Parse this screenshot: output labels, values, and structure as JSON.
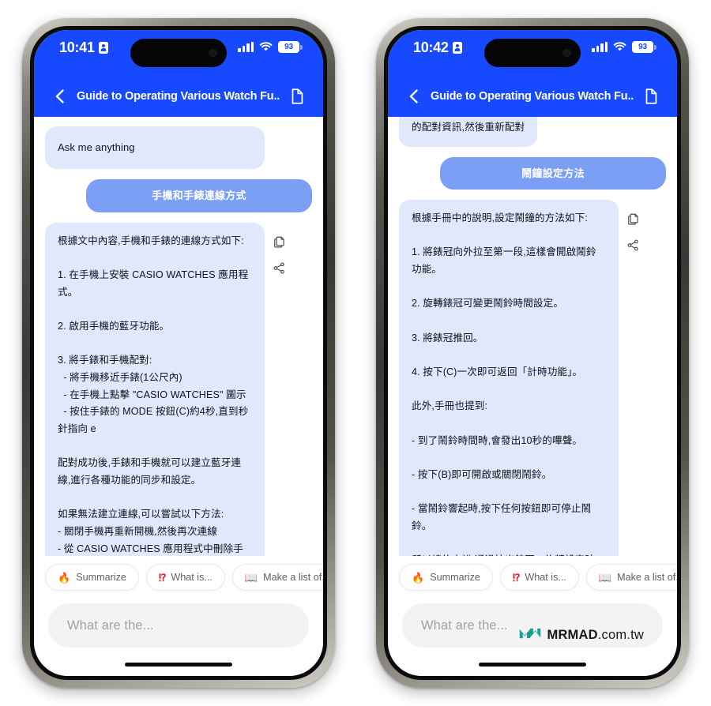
{
  "watermark": {
    "brand": "MRMAD",
    "domain": ".com.tw",
    "logo_color": "#1a9e93",
    "icon": "mrmad-logo-icon"
  },
  "theme": {
    "header_blue": "#1749ff",
    "user_bubble_blue": "#7c9ff6",
    "ai_bubble_blue": "#dfe9fb",
    "input_gray": "#f3f3f3"
  },
  "phones": [
    {
      "id": "left",
      "status": {
        "time": "10:41",
        "id_icon": "id-badge-icon",
        "signal_icon": "cellular-signal-icon",
        "wifi_icon": "wifi-icon",
        "battery_level": "93"
      },
      "nav": {
        "back_icon": "chevron-left-icon",
        "title": "Guide to Operating Various Watch Fu...",
        "doc_icon": "document-icon"
      },
      "messages": [
        {
          "role": "assistant",
          "kind": "greeting",
          "text": "Ask me anything"
        },
        {
          "role": "user",
          "text": "手機和手錶連線方式"
        },
        {
          "role": "assistant",
          "kind": "answer",
          "text": "根據文中內容,手機和手錶的連線方式如下:\n\n1. 在手機上安裝 CASIO WATCHES 應用程式。\n\n2. 啟用手機的藍牙功能。\n\n3. 將手錶和手機配對:\n  - 將手機移近手錶(1公尺內)\n  - 在手機上點擊 \"CASIO WATCHES\" 圖示\n  - 按住手錶的 MODE 按鈕(C)約4秒,直到秒針指向 e\n\n配對成功後,手錶和手機就可以建立藍牙連線,進行各種功能的同步和設定。\n\n如果無法建立連線,可以嘗試以下方法:\n- 關閉手機再重新開機,然後再次連線\n- 從 CASIO WATCHES 應用程式中刪除手錶的配對資訊,然後重新配對",
          "actions": [
            {
              "name": "copy-icon",
              "label": "Copy"
            },
            {
              "name": "share-icon",
              "label": "Share"
            }
          ]
        }
      ],
      "chips": [
        {
          "emoji": "🔥",
          "icon": "fire-icon",
          "label": "Summarize"
        },
        {
          "emoji": "⁉",
          "icon": "exclamation-question-icon",
          "label": "What is..."
        },
        {
          "emoji": "📖",
          "icon": "book-icon",
          "label": "Make a list of..."
        }
      ],
      "composer": {
        "placeholder": "What are the..."
      }
    },
    {
      "id": "right",
      "status": {
        "time": "10:42",
        "id_icon": "id-badge-icon",
        "signal_icon": "cellular-signal-icon",
        "wifi_icon": "wifi-icon",
        "battery_level": "93"
      },
      "nav": {
        "back_icon": "chevron-left-icon",
        "title": "Guide to Operating Various Watch Fu...",
        "doc_icon": "document-icon"
      },
      "messages": [
        {
          "role": "assistant",
          "kind": "clipped",
          "text": "的配對資訊,然後重新配對"
        },
        {
          "role": "user",
          "text": "鬧鐘設定方法"
        },
        {
          "role": "assistant",
          "kind": "answer",
          "text": "根據手冊中的說明,設定鬧鐘的方法如下:\n\n1. 將錶冠向外拉至第一段,這樣會開啟鬧鈴功能。\n\n2. 旋轉錶冠可變更鬧鈴時間設定。\n\n3. 將錶冠推回。\n\n4. 按下(C)一次即可返回「計時功能」。\n\n此外,手冊也提到:\n\n- 到了鬧鈴時間時,會發出10秒的嗶聲。\n\n- 按下(B)即可開啟或關閉鬧鈴。\n\n- 當鬧鈴響起時,按下任何按鈕即可停止鬧鈴。\n\n所以總的來說,通過拉出錶冠、旋轉設定時間、推回錶冠,就可以完成鬧鐘的設定。",
          "actions": [
            {
              "name": "copy-icon",
              "label": "Copy"
            },
            {
              "name": "share-icon",
              "label": "Share"
            }
          ]
        }
      ],
      "chips": [
        {
          "emoji": "🔥",
          "icon": "fire-icon",
          "label": "Summarize"
        },
        {
          "emoji": "⁉",
          "icon": "exclamation-question-icon",
          "label": "What is..."
        },
        {
          "emoji": "📖",
          "icon": "book-icon",
          "label": "Make a list of..."
        }
      ],
      "composer": {
        "placeholder": "What are the..."
      }
    }
  ]
}
